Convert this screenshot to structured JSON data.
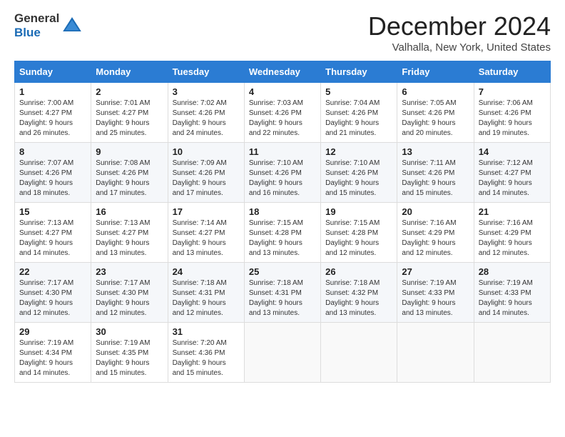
{
  "header": {
    "logo_line1": "General",
    "logo_line2": "Blue",
    "month_title": "December 2024",
    "location": "Valhalla, New York, United States"
  },
  "days_of_week": [
    "Sunday",
    "Monday",
    "Tuesday",
    "Wednesday",
    "Thursday",
    "Friday",
    "Saturday"
  ],
  "weeks": [
    [
      {
        "day": "1",
        "sunrise": "Sunrise: 7:00 AM",
        "sunset": "Sunset: 4:27 PM",
        "daylight": "Daylight: 9 hours and 26 minutes."
      },
      {
        "day": "2",
        "sunrise": "Sunrise: 7:01 AM",
        "sunset": "Sunset: 4:27 PM",
        "daylight": "Daylight: 9 hours and 25 minutes."
      },
      {
        "day": "3",
        "sunrise": "Sunrise: 7:02 AM",
        "sunset": "Sunset: 4:26 PM",
        "daylight": "Daylight: 9 hours and 24 minutes."
      },
      {
        "day": "4",
        "sunrise": "Sunrise: 7:03 AM",
        "sunset": "Sunset: 4:26 PM",
        "daylight": "Daylight: 9 hours and 22 minutes."
      },
      {
        "day": "5",
        "sunrise": "Sunrise: 7:04 AM",
        "sunset": "Sunset: 4:26 PM",
        "daylight": "Daylight: 9 hours and 21 minutes."
      },
      {
        "day": "6",
        "sunrise": "Sunrise: 7:05 AM",
        "sunset": "Sunset: 4:26 PM",
        "daylight": "Daylight: 9 hours and 20 minutes."
      },
      {
        "day": "7",
        "sunrise": "Sunrise: 7:06 AM",
        "sunset": "Sunset: 4:26 PM",
        "daylight": "Daylight: 9 hours and 19 minutes."
      }
    ],
    [
      {
        "day": "8",
        "sunrise": "Sunrise: 7:07 AM",
        "sunset": "Sunset: 4:26 PM",
        "daylight": "Daylight: 9 hours and 18 minutes."
      },
      {
        "day": "9",
        "sunrise": "Sunrise: 7:08 AM",
        "sunset": "Sunset: 4:26 PM",
        "daylight": "Daylight: 9 hours and 17 minutes."
      },
      {
        "day": "10",
        "sunrise": "Sunrise: 7:09 AM",
        "sunset": "Sunset: 4:26 PM",
        "daylight": "Daylight: 9 hours and 17 minutes."
      },
      {
        "day": "11",
        "sunrise": "Sunrise: 7:10 AM",
        "sunset": "Sunset: 4:26 PM",
        "daylight": "Daylight: 9 hours and 16 minutes."
      },
      {
        "day": "12",
        "sunrise": "Sunrise: 7:10 AM",
        "sunset": "Sunset: 4:26 PM",
        "daylight": "Daylight: 9 hours and 15 minutes."
      },
      {
        "day": "13",
        "sunrise": "Sunrise: 7:11 AM",
        "sunset": "Sunset: 4:26 PM",
        "daylight": "Daylight: 9 hours and 15 minutes."
      },
      {
        "day": "14",
        "sunrise": "Sunrise: 7:12 AM",
        "sunset": "Sunset: 4:27 PM",
        "daylight": "Daylight: 9 hours and 14 minutes."
      }
    ],
    [
      {
        "day": "15",
        "sunrise": "Sunrise: 7:13 AM",
        "sunset": "Sunset: 4:27 PM",
        "daylight": "Daylight: 9 hours and 14 minutes."
      },
      {
        "day": "16",
        "sunrise": "Sunrise: 7:13 AM",
        "sunset": "Sunset: 4:27 PM",
        "daylight": "Daylight: 9 hours and 13 minutes."
      },
      {
        "day": "17",
        "sunrise": "Sunrise: 7:14 AM",
        "sunset": "Sunset: 4:27 PM",
        "daylight": "Daylight: 9 hours and 13 minutes."
      },
      {
        "day": "18",
        "sunrise": "Sunrise: 7:15 AM",
        "sunset": "Sunset: 4:28 PM",
        "daylight": "Daylight: 9 hours and 13 minutes."
      },
      {
        "day": "19",
        "sunrise": "Sunrise: 7:15 AM",
        "sunset": "Sunset: 4:28 PM",
        "daylight": "Daylight: 9 hours and 12 minutes."
      },
      {
        "day": "20",
        "sunrise": "Sunrise: 7:16 AM",
        "sunset": "Sunset: 4:29 PM",
        "daylight": "Daylight: 9 hours and 12 minutes."
      },
      {
        "day": "21",
        "sunrise": "Sunrise: 7:16 AM",
        "sunset": "Sunset: 4:29 PM",
        "daylight": "Daylight: 9 hours and 12 minutes."
      }
    ],
    [
      {
        "day": "22",
        "sunrise": "Sunrise: 7:17 AM",
        "sunset": "Sunset: 4:30 PM",
        "daylight": "Daylight: 9 hours and 12 minutes."
      },
      {
        "day": "23",
        "sunrise": "Sunrise: 7:17 AM",
        "sunset": "Sunset: 4:30 PM",
        "daylight": "Daylight: 9 hours and 12 minutes."
      },
      {
        "day": "24",
        "sunrise": "Sunrise: 7:18 AM",
        "sunset": "Sunset: 4:31 PM",
        "daylight": "Daylight: 9 hours and 12 minutes."
      },
      {
        "day": "25",
        "sunrise": "Sunrise: 7:18 AM",
        "sunset": "Sunset: 4:31 PM",
        "daylight": "Daylight: 9 hours and 13 minutes."
      },
      {
        "day": "26",
        "sunrise": "Sunrise: 7:18 AM",
        "sunset": "Sunset: 4:32 PM",
        "daylight": "Daylight: 9 hours and 13 minutes."
      },
      {
        "day": "27",
        "sunrise": "Sunrise: 7:19 AM",
        "sunset": "Sunset: 4:33 PM",
        "daylight": "Daylight: 9 hours and 13 minutes."
      },
      {
        "day": "28",
        "sunrise": "Sunrise: 7:19 AM",
        "sunset": "Sunset: 4:33 PM",
        "daylight": "Daylight: 9 hours and 14 minutes."
      }
    ],
    [
      {
        "day": "29",
        "sunrise": "Sunrise: 7:19 AM",
        "sunset": "Sunset: 4:34 PM",
        "daylight": "Daylight: 9 hours and 14 minutes."
      },
      {
        "day": "30",
        "sunrise": "Sunrise: 7:19 AM",
        "sunset": "Sunset: 4:35 PM",
        "daylight": "Daylight: 9 hours and 15 minutes."
      },
      {
        "day": "31",
        "sunrise": "Sunrise: 7:20 AM",
        "sunset": "Sunset: 4:36 PM",
        "daylight": "Daylight: 9 hours and 15 minutes."
      },
      null,
      null,
      null,
      null
    ]
  ]
}
